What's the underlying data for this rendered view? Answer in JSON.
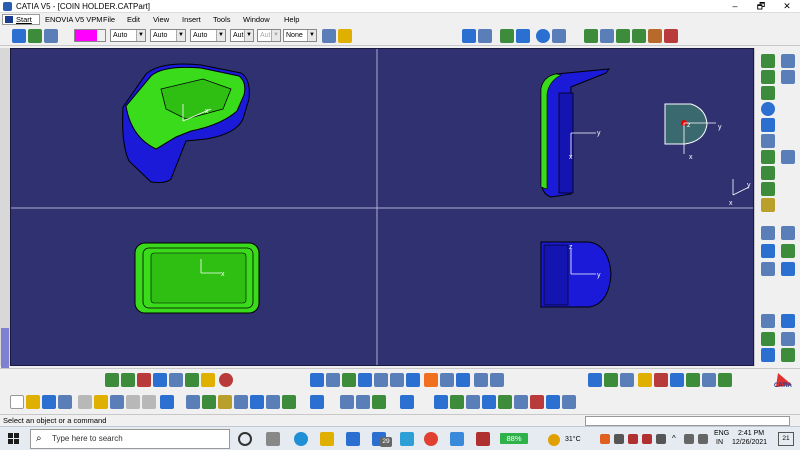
{
  "window": {
    "title": "CATIA V5 - [COIN HOLDER.CATPart]",
    "minimize": "–",
    "restore": "🗗",
    "close": "✕"
  },
  "menubar": {
    "start": "Start",
    "items": [
      "ENOVIA V5 VPM",
      "File",
      "Edit",
      "View",
      "Insert",
      "Tools",
      "Window",
      "Help"
    ]
  },
  "toolbar": {
    "color_swatch": "#ff00ff",
    "combos": [
      "Auto",
      "Auto",
      "Auto",
      "Aut",
      "Aut",
      "None"
    ]
  },
  "viewport": {
    "background": "#2f3170",
    "axes": {
      "top_right_y": "y",
      "top_right_x": "x",
      "bottom_right_z": "z",
      "bottom_right_y": "y",
      "bottom_left_x": "x",
      "top_left_x": "x",
      "compass_z": "z",
      "compass_y": "y",
      "compass_x": "x",
      "corner_y": "y",
      "corner_x": "x"
    }
  },
  "statusbar": {
    "message": "Select an object or a command"
  },
  "taskbar": {
    "search_placeholder": "Type here to search",
    "mail_badge": "29",
    "battery": "88%",
    "temperature": "31°C",
    "lang1": "ENG",
    "lang2": "IN",
    "time": "2:41 PM",
    "date": "12/26/2021",
    "notif": "21"
  },
  "brand": {
    "logo_text": "CATIA"
  }
}
